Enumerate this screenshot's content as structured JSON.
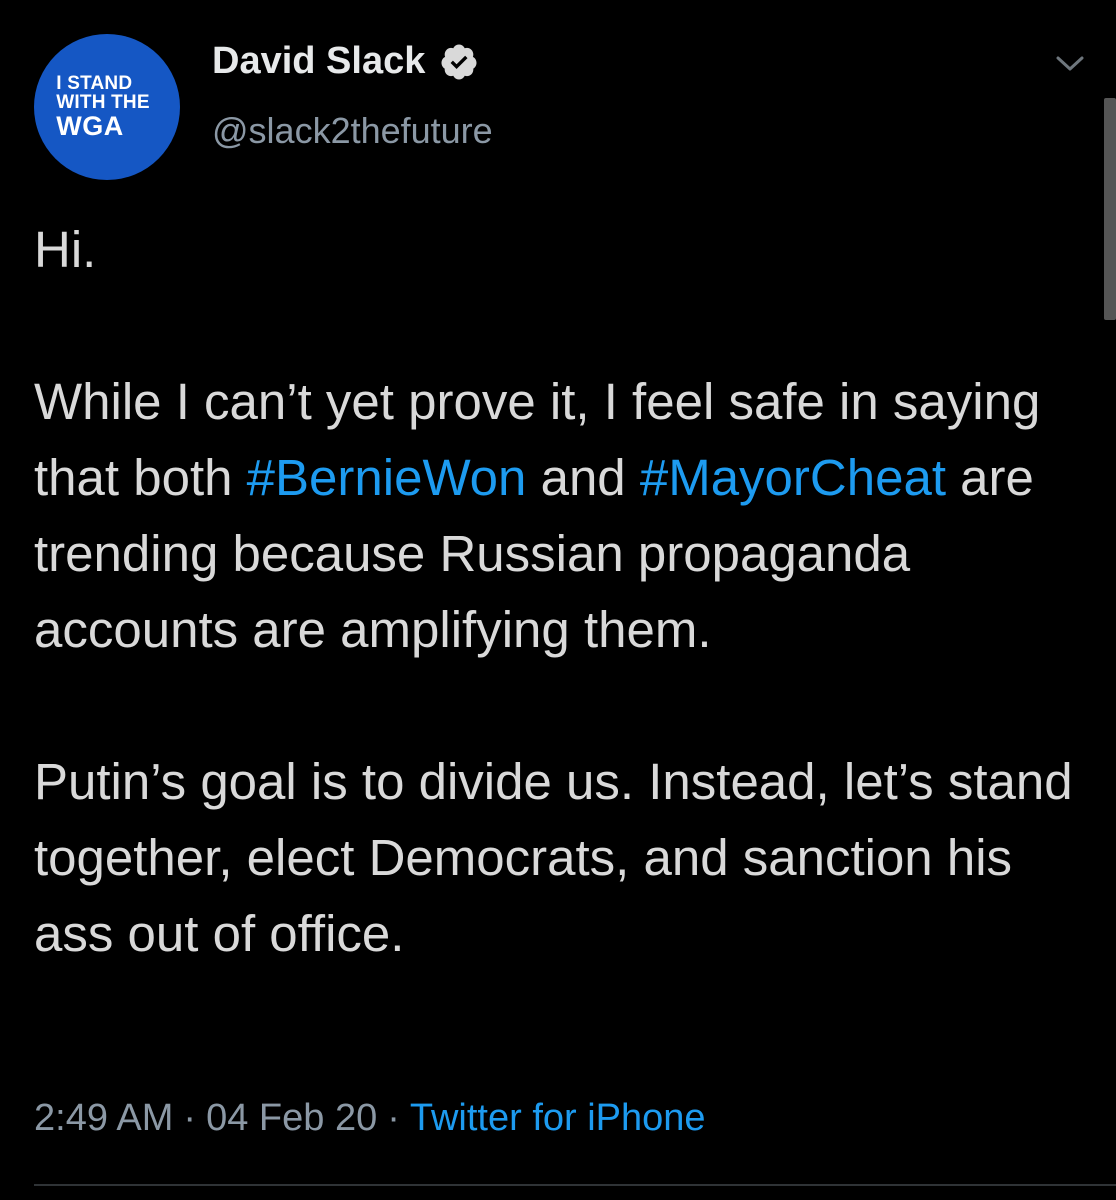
{
  "avatar": {
    "line1": "I STAND",
    "line2": "WITH THE",
    "line3": "WGA",
    "background": "#1557c4"
  },
  "author": {
    "display_name": "David Slack",
    "handle": "@slack2thefuture",
    "verified_icon": "verified-badge-icon"
  },
  "menu_icon": "chevron-down-icon",
  "tweet": {
    "para1": "Hi.",
    "para2": {
      "part1": "While I can’t yet prove it, I feel safe in saying that both ",
      "hashtag1": "#BernieWon",
      "part2": " and ",
      "hashtag2": "#MayorCheat",
      "part3": " are trending because Russian propaganda accounts are amplifying them."
    },
    "para3": "Putin’s goal is to divide us. Instead, let’s stand together, elect Democrats, and sanction his ass out of office."
  },
  "meta": {
    "time": "2:49 AM",
    "date": "04 Feb 20",
    "separator": "·",
    "source": "Twitter for iPhone"
  },
  "colors": {
    "background": "#000000",
    "text": "#d9d9d9",
    "link": "#1d9bf0",
    "muted": "#8b98a5"
  }
}
